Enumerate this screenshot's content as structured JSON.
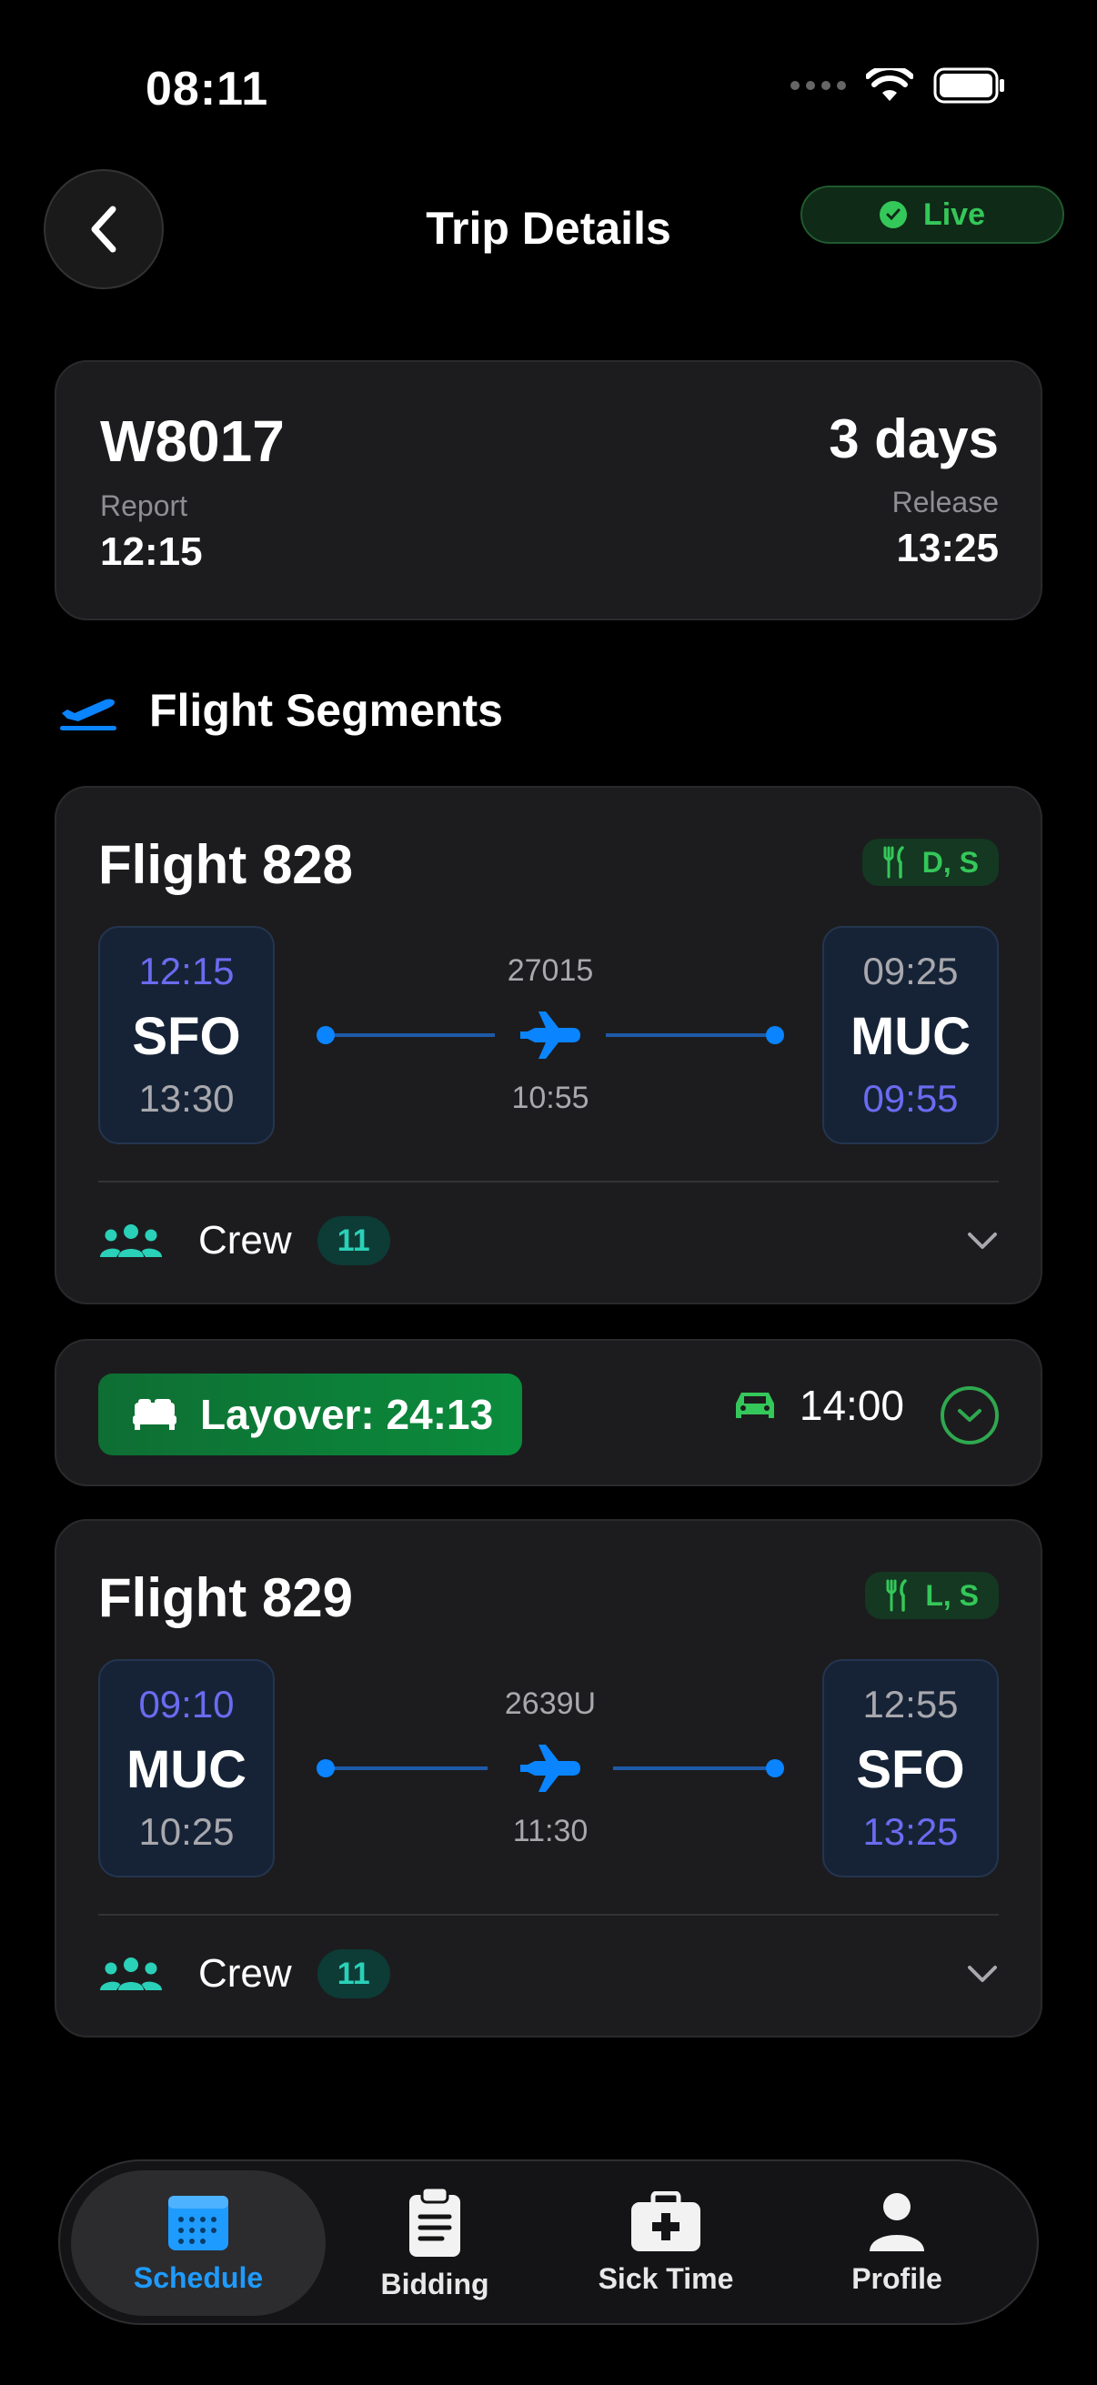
{
  "status_bar": {
    "time": "08:11"
  },
  "header": {
    "title": "Trip Details",
    "live_label": "Live"
  },
  "trip": {
    "id": "W8017",
    "report_label": "Report",
    "report_time": "12:15",
    "duration": "3 days",
    "release_label": "Release",
    "release_time": "13:25"
  },
  "section": {
    "title": "Flight Segments"
  },
  "flights": [
    {
      "title": "Flight 828",
      "meals": "D, S",
      "origin": {
        "top_time": "12:15",
        "code": "SFO",
        "bottom_time": "13:30"
      },
      "aircraft": "27015",
      "duration": "10:55",
      "destination": {
        "top_time": "09:25",
        "code": "MUC",
        "bottom_time": "09:55"
      },
      "crew_label": "Crew",
      "crew_count": "11"
    },
    {
      "title": "Flight 829",
      "meals": "L, S",
      "origin": {
        "top_time": "09:10",
        "code": "MUC",
        "bottom_time": "10:25"
      },
      "aircraft": "2639U",
      "duration": "11:30",
      "destination": {
        "top_time": "12:55",
        "code": "SFO",
        "bottom_time": "13:25"
      },
      "crew_label": "Crew",
      "crew_count": "11"
    }
  ],
  "layover": {
    "label": "Layover: 24:13",
    "car_time": "14:00"
  },
  "tabs": [
    {
      "label": "Schedule",
      "icon": "calendar-icon",
      "active": true
    },
    {
      "label": "Bidding",
      "icon": "clipboard-icon",
      "active": false
    },
    {
      "label": "Sick Time",
      "icon": "medical-kit-icon",
      "active": false
    },
    {
      "label": "Profile",
      "icon": "person-icon",
      "active": false
    }
  ],
  "colors": {
    "accent_blue": "#0a84ff",
    "live_green": "#34c759",
    "purple_time": "#6b6bf0",
    "crew_teal": "#2ad0b8"
  }
}
